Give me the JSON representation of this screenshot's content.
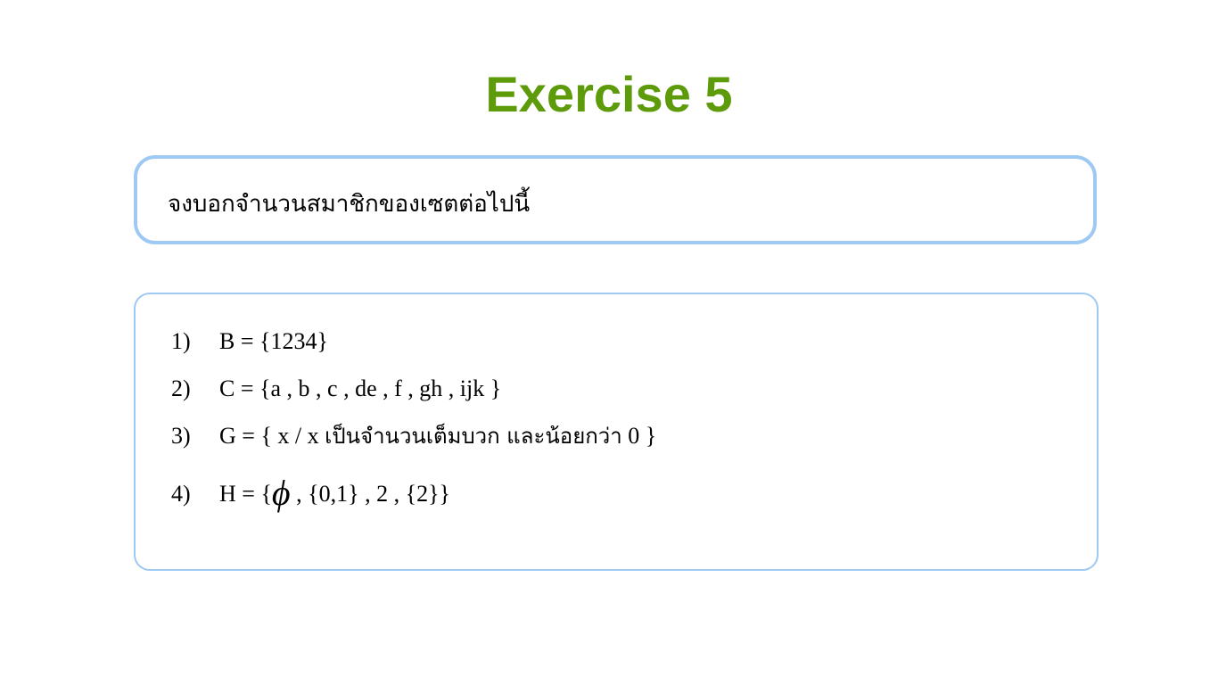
{
  "title": "Exercise 5",
  "instruction": "จงบอกจำนวนสมาชิกของเซตต่อไปนี้",
  "items": [
    {
      "number": "1)",
      "expression": "B = {1234}"
    },
    {
      "number": "2)",
      "expression": "C = {a , b , c , de , f , gh , ijk }"
    },
    {
      "number": "3)",
      "prefix": "G = { x / x ",
      "thai": "เป็นจำนวนเต็มบวก และน้อยกว่า",
      "suffix": " 0 }"
    },
    {
      "number": "4)",
      "prefix": "H = {",
      "symbol": "ϕ",
      "suffix": " , {0,1} , 2 , {2}}"
    }
  ],
  "colors": {
    "title": "#5e9b0a",
    "box_border": "#9ec9f2"
  }
}
